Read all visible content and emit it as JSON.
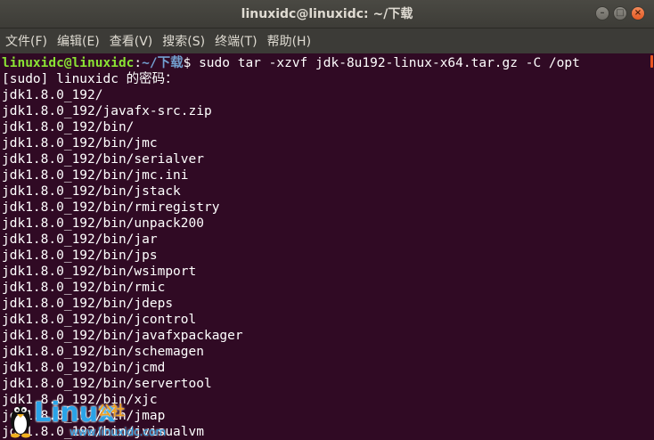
{
  "window": {
    "title": "linuxidc@linuxidc: ~/下载",
    "buttons": {
      "minimize": "–",
      "maximize": "□",
      "close": "×"
    }
  },
  "menubar": {
    "items": [
      "文件(F)",
      "编辑(E)",
      "查看(V)",
      "搜索(S)",
      "终端(T)",
      "帮助(H)"
    ]
  },
  "terminal": {
    "prompt": {
      "user": "linuxidc@linuxidc",
      "colon": ":",
      "path": "~/下载",
      "dollar": "$",
      "command": " sudo tar -xzvf jdk-8u192-linux-x64.tar.gz -C /opt"
    },
    "lines": [
      "[sudo] linuxidc 的密码：",
      "jdk1.8.0_192/",
      "jdk1.8.0_192/javafx-src.zip",
      "jdk1.8.0_192/bin/",
      "jdk1.8.0_192/bin/jmc",
      "jdk1.8.0_192/bin/serialver",
      "jdk1.8.0_192/bin/jmc.ini",
      "jdk1.8.0_192/bin/jstack",
      "jdk1.8.0_192/bin/rmiregistry",
      "jdk1.8.0_192/bin/unpack200",
      "jdk1.8.0_192/bin/jar",
      "jdk1.8.0_192/bin/jps",
      "jdk1.8.0_192/bin/wsimport",
      "jdk1.8.0_192/bin/rmic",
      "jdk1.8.0_192/bin/jdeps",
      "jdk1.8.0_192/bin/jcontrol",
      "jdk1.8.0_192/bin/javafxpackager",
      "jdk1.8.0_192/bin/schemagen",
      "jdk1.8.0_192/bin/jcmd",
      "jdk1.8.0_192/bin/servertool",
      "jdk1.8.0_192/bin/xjc",
      "jdk1.8.0_192/bin/jmap",
      "jdk1.8.0_192/bin/jvisualvm"
    ]
  },
  "watermark": {
    "brand": "Linux",
    "sub": "公社",
    "url": "www.linuxidc.com"
  },
  "colors": {
    "background": "#300a24",
    "prompt_user": "#8ae234",
    "prompt_path": "#729fcf",
    "accent": "#e95420"
  }
}
